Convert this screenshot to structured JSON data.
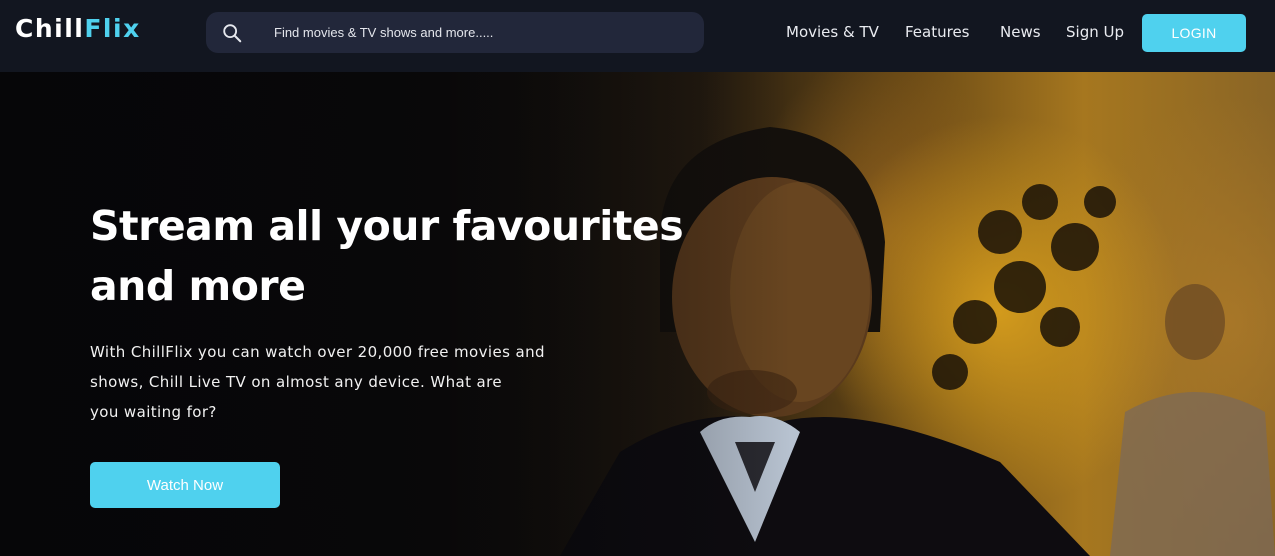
{
  "header": {
    "logo": {
      "part_a": "Chill",
      "part_b": "Flix"
    },
    "search": {
      "placeholder": "Find movies & TV shows and more.....",
      "icon": "search-icon"
    },
    "nav": [
      {
        "label": "Movies & TV"
      },
      {
        "label": "Features"
      },
      {
        "label": "News"
      },
      {
        "label": "Sign Up"
      }
    ],
    "login_label": "LOGIN"
  },
  "hero": {
    "title_line1": "Stream all your favourites",
    "title_line2": "and more",
    "text_line1": "With ChillFlix you can watch over 20,000 free movies and",
    "text_line2": "shows, Chill Live TV on almost any device. What are",
    "text_line3": "you waiting for?",
    "cta_label": "Watch Now"
  },
  "colors": {
    "accent": "#4fd1ee",
    "nav_bg": "#121620",
    "search_bg": "#22273a"
  }
}
